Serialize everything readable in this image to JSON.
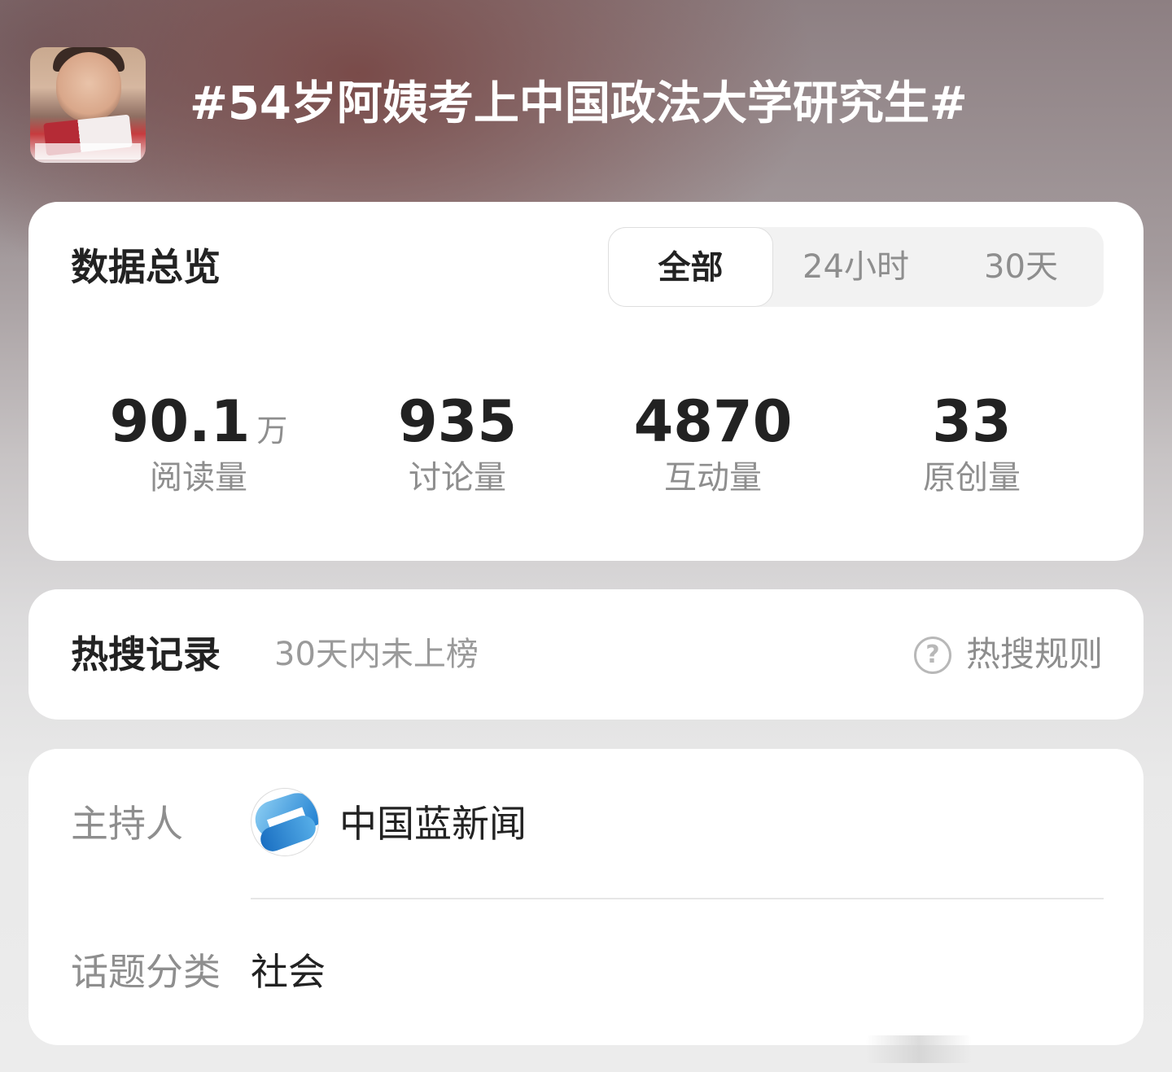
{
  "header": {
    "title": "#54岁阿姨考上中国政法大学研究生#",
    "thumbnail_icon": "topic-video-thumbnail"
  },
  "overview": {
    "title": "数据总览",
    "tabs": [
      {
        "label": "全部",
        "active": true
      },
      {
        "label": "24小时",
        "active": false
      },
      {
        "label": "30天",
        "active": false
      }
    ],
    "stats": [
      {
        "value": "90.1",
        "unit": "万",
        "label": "阅读量"
      },
      {
        "value": "935",
        "unit": "",
        "label": "讨论量"
      },
      {
        "value": "4870",
        "unit": "",
        "label": "互动量"
      },
      {
        "value": "33",
        "unit": "",
        "label": "原创量"
      }
    ]
  },
  "hot_search": {
    "title": "热搜记录",
    "status": "30天内未上榜",
    "rules_label": "热搜规则",
    "rules_icon": "question-circle-icon",
    "rules_icon_glyph": "?"
  },
  "info": {
    "host_label": "主持人",
    "host_name": "中国蓝新闻",
    "host_logo_icon": "news-logo-icon",
    "category_label": "话题分类",
    "category_value": "社会"
  },
  "colors": {
    "primary_text": "#222222",
    "secondary_text": "#8e8e8e",
    "card_background": "#ffffff",
    "segment_background": "#f2f2f2"
  }
}
